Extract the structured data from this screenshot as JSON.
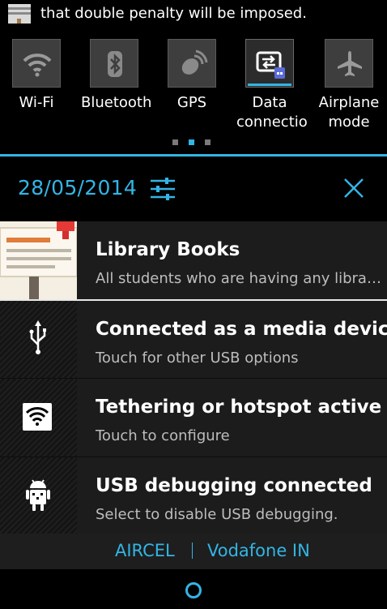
{
  "ticker": {
    "text": "that double penalty will be imposed.",
    "icon": "library-notice-icon"
  },
  "quick_settings": {
    "tiles": [
      {
        "label": "Wi-Fi",
        "icon": "wifi-icon",
        "active": false
      },
      {
        "label": "Bluetooth",
        "icon": "bluetooth-icon",
        "active": false
      },
      {
        "label": "GPS",
        "icon": "gps-icon",
        "active": false
      },
      {
        "label": "Data connectio",
        "icon": "data-connection-icon",
        "active": true
      },
      {
        "label": "Airplane mode",
        "icon": "airplane-icon",
        "active": false
      }
    ],
    "pages": 3,
    "current_page": 2,
    "accent_color": "#33b5e5"
  },
  "header": {
    "date": "28/05/2014",
    "settings_icon": "sliders-icon",
    "clear_icon": "close-icon"
  },
  "notifications": [
    {
      "title": "Library Books",
      "subtitle": "All students who are having any libra…",
      "icon": "library-notice-icon"
    },
    {
      "title": "Connected as a media device",
      "subtitle": "Touch for other USB options",
      "icon": "usb-icon"
    },
    {
      "title": "Tethering or hotspot active",
      "subtitle": "Touch to configure",
      "icon": "hotspot-icon"
    },
    {
      "title": "USB debugging connected",
      "subtitle": "Select to disable USB debugging.",
      "icon": "android-debug-icon"
    }
  ],
  "carriers": {
    "left": "AIRCEL",
    "right": "Vodafone IN"
  },
  "handle": {
    "icon": "handle-circle-icon"
  }
}
